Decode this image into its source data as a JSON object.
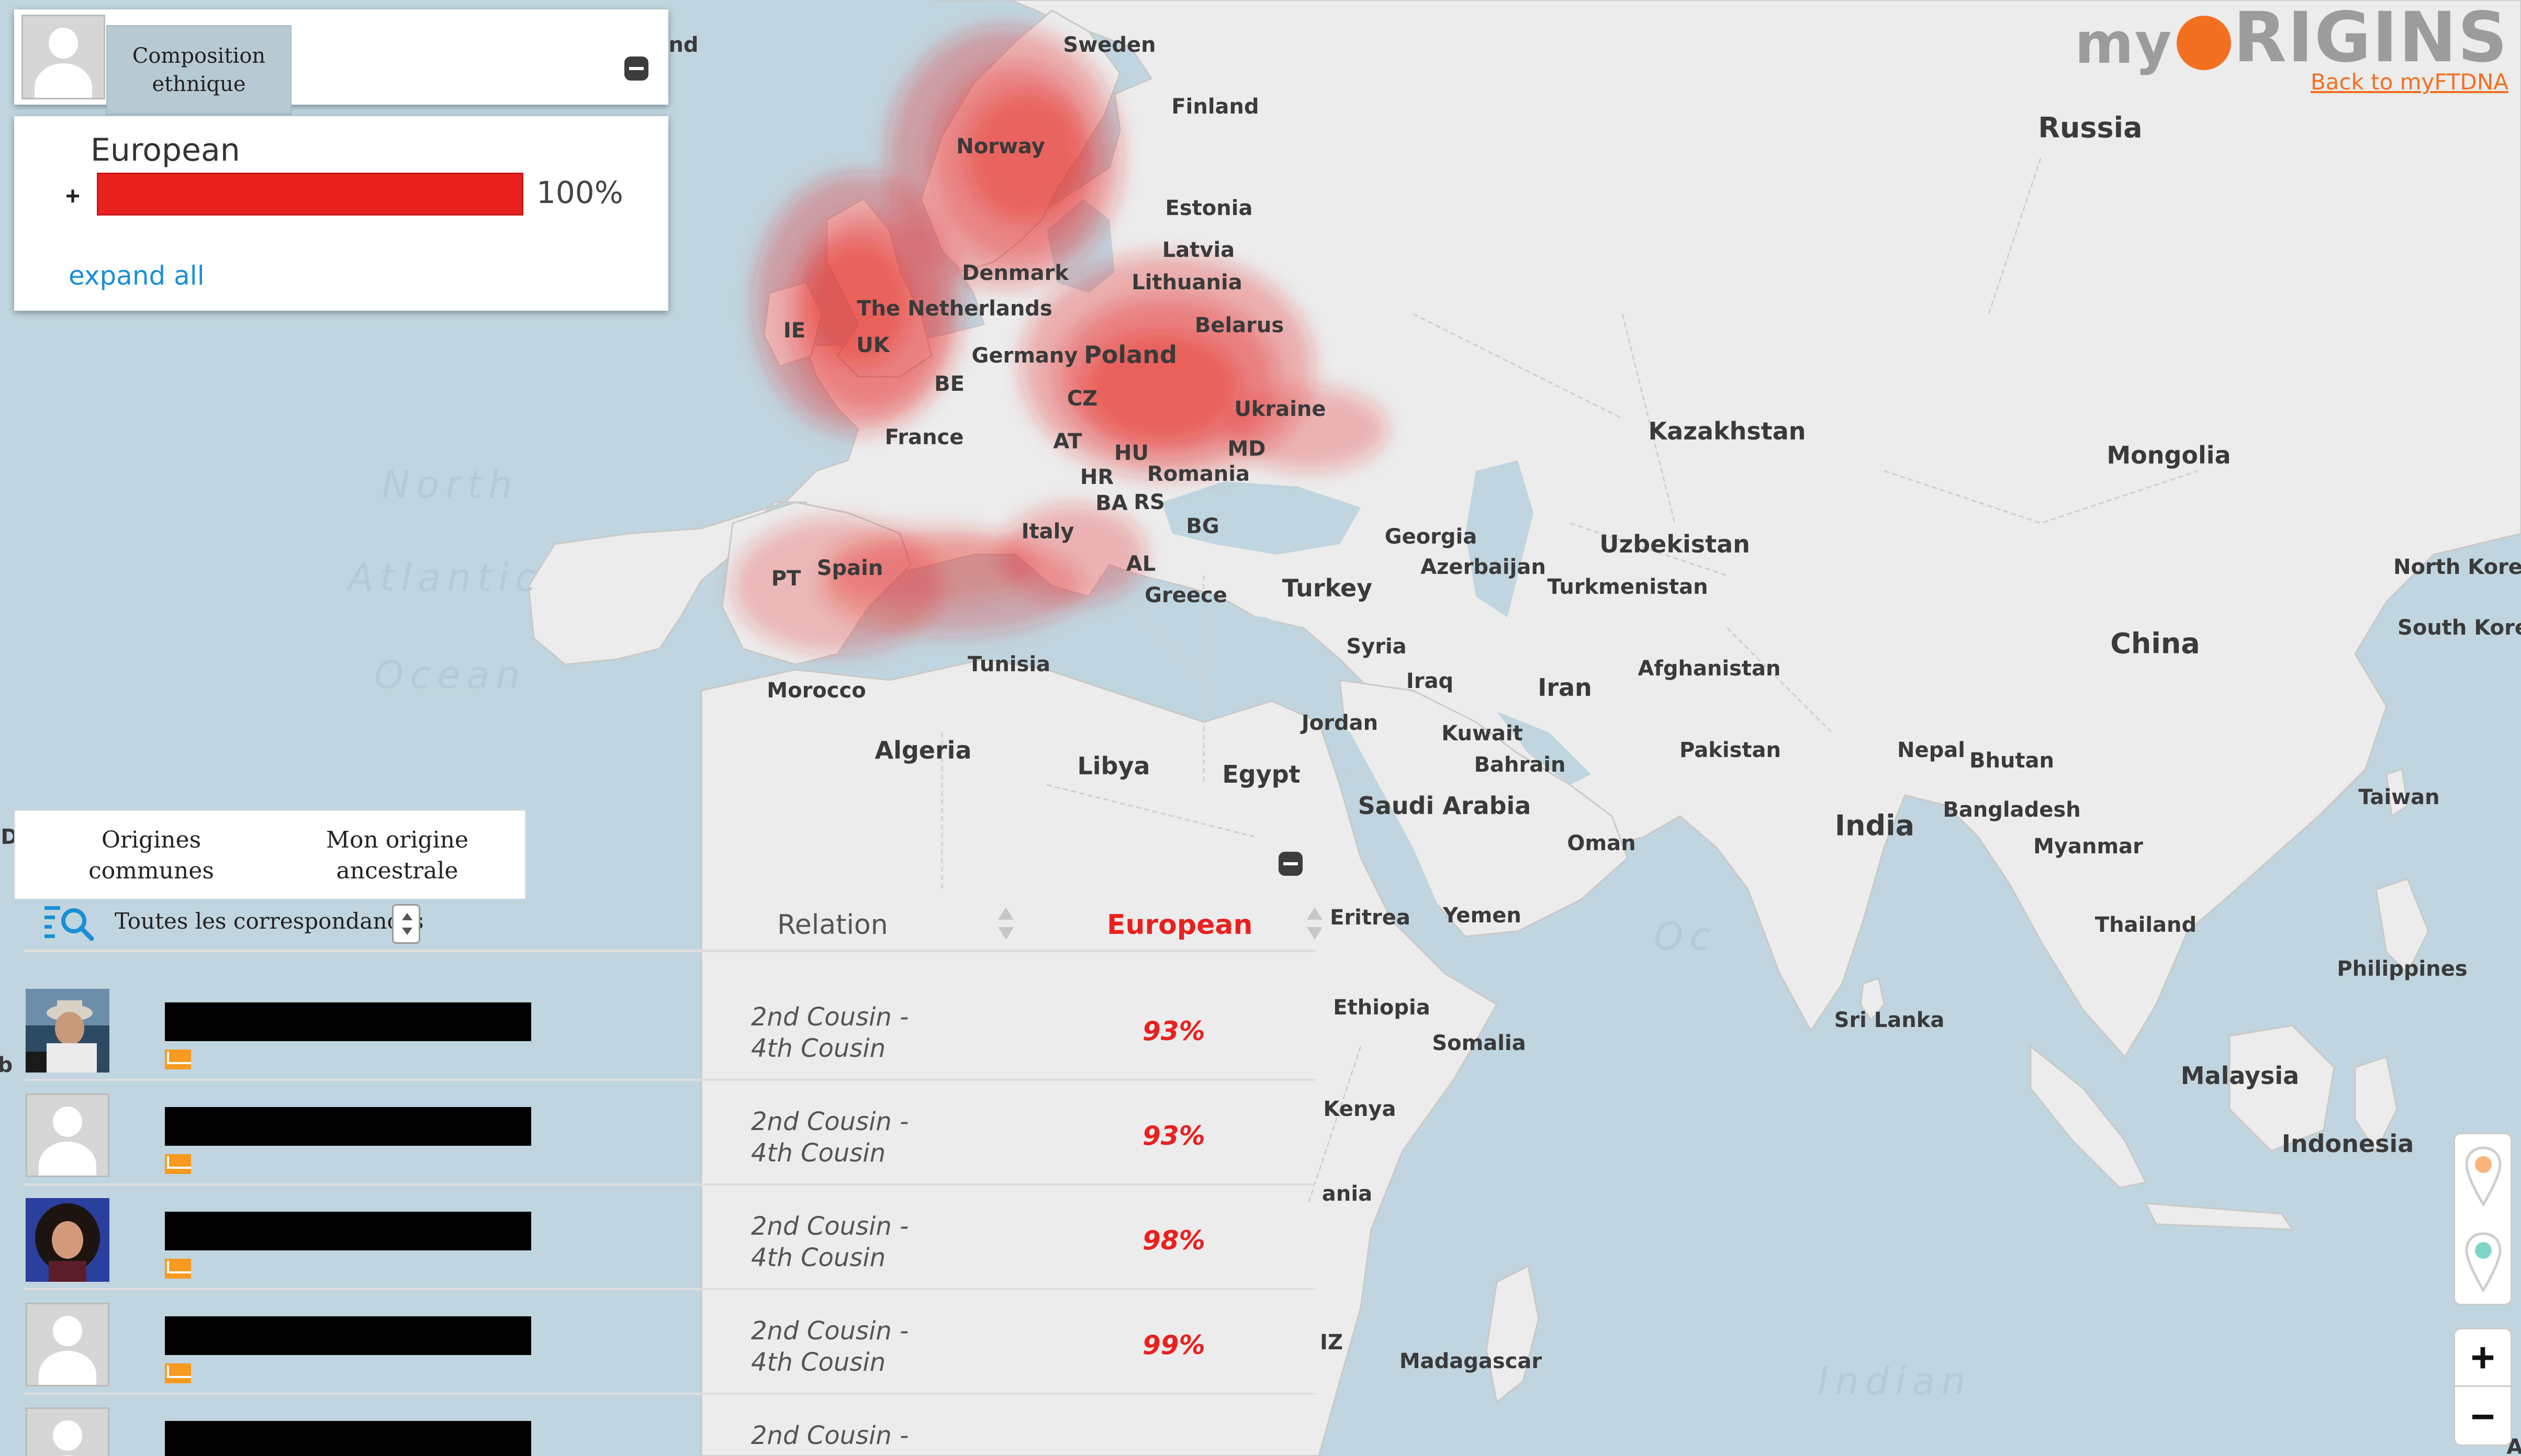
{
  "brand": {
    "my": "my",
    "origins": "RIGINS",
    "back_link": "Back to myFTDNA"
  },
  "ethnic_panel": {
    "tab_label": "Composition ethnique",
    "population": "European",
    "bar_fraction": 1.0,
    "percent": "100%",
    "expand_label": "expand all",
    "plus": "+"
  },
  "matches_panel": {
    "tabs": [
      "Origines communes",
      "Mon origine ancestrale"
    ],
    "filter_label": "Toutes les correspondances",
    "col_relation": "Relation",
    "col_population": "European",
    "rows": [
      {
        "rel1": "2nd Cousin -",
        "rel2": "4th Cousin",
        "pct": "93%",
        "photo": "man-hat"
      },
      {
        "rel1": "2nd Cousin -",
        "rel2": "4th Cousin",
        "pct": "93%",
        "photo": "placeholder"
      },
      {
        "rel1": "2nd Cousin -",
        "rel2": "4th Cousin",
        "pct": "98%",
        "photo": "woman"
      },
      {
        "rel1": "2nd Cousin -",
        "rel2": "4th Cousin",
        "pct": "99%",
        "photo": "placeholder"
      },
      {
        "rel1": "2nd Cousin -",
        "rel2": "",
        "pct": "",
        "photo": "placeholder"
      }
    ]
  },
  "map": {
    "countries": {
      "sweden": "Sweden",
      "finland": "Finland",
      "norway": "Norway",
      "estonia": "Estonia",
      "latvia": "Latvia",
      "lithuania": "Lithuania",
      "denmark": "Denmark",
      "netherlands": "The Netherlands",
      "belarus": "Belarus",
      "ie": "IE",
      "uk": "UK",
      "germany": "Germany",
      "poland": "Poland",
      "be": "BE",
      "cz": "CZ",
      "ukraine": "Ukraine",
      "france": "France",
      "at": "AT",
      "hu": "HU",
      "md": "MD",
      "romania": "Romania",
      "hr": "HR",
      "ba": "BA",
      "rs": "RS",
      "bg": "BG",
      "italy": "Italy",
      "spain": "Spain",
      "pt": "PT",
      "al": "AL",
      "greece": "Greece",
      "tunisia": "Tunisia",
      "morocco": "Morocco",
      "algeria": "Algeria",
      "libya": "Libya",
      "egypt": "Egypt",
      "turkey": "Turkey",
      "georgia": "Georgia",
      "azerbaijan": "Azerbaijan",
      "syria": "Syria",
      "iraq": "Iraq",
      "jordan": "Jordan",
      "iran": "Iran",
      "kuwait": "Kuwait",
      "bahrain": "Bahrain",
      "saudi": "Saudi Arabia",
      "oman": "Oman",
      "yemen": "Yemen",
      "eritrea": "Eritrea",
      "ethiopia": "Ethiopia",
      "somalia": "Somalia",
      "kenya": "Kenya",
      "tanzania_frag": "ania",
      "mz_frag": "IZ",
      "madagascar": "Madagascar",
      "russia": "Russia",
      "kazakhstan": "Kazakhstan",
      "uzbekistan": "Uzbekistan",
      "turkmenistan": "Turkmenistan",
      "afghanistan": "Afghanistan",
      "pakistan": "Pakistan",
      "mongolia": "Mongolia",
      "china": "China",
      "india": "India",
      "nepal": "Nepal",
      "bhutan": "Bhutan",
      "bangladesh": "Bangladesh",
      "myanmar": "Myanmar",
      "thailand": "Thailand",
      "srilanka": "Sri Lanka",
      "malaysia": "Malaysia",
      "indonesia": "Indonesia",
      "philippines": "Philippines",
      "taiwan": "Taiwan",
      "nkorea": "North Korea",
      "skorea": "South Korea",
      "iceland_frag": "nd",
      "west_frag_d": "D",
      "west_frag_b": "b",
      "corner_a": "A"
    },
    "oceans": {
      "north": "North",
      "atlantic": "Atlantic",
      "ocean": "Ocean",
      "indian": "Indian",
      "oc2": "Oc"
    },
    "heat_color": "#e8211f"
  }
}
